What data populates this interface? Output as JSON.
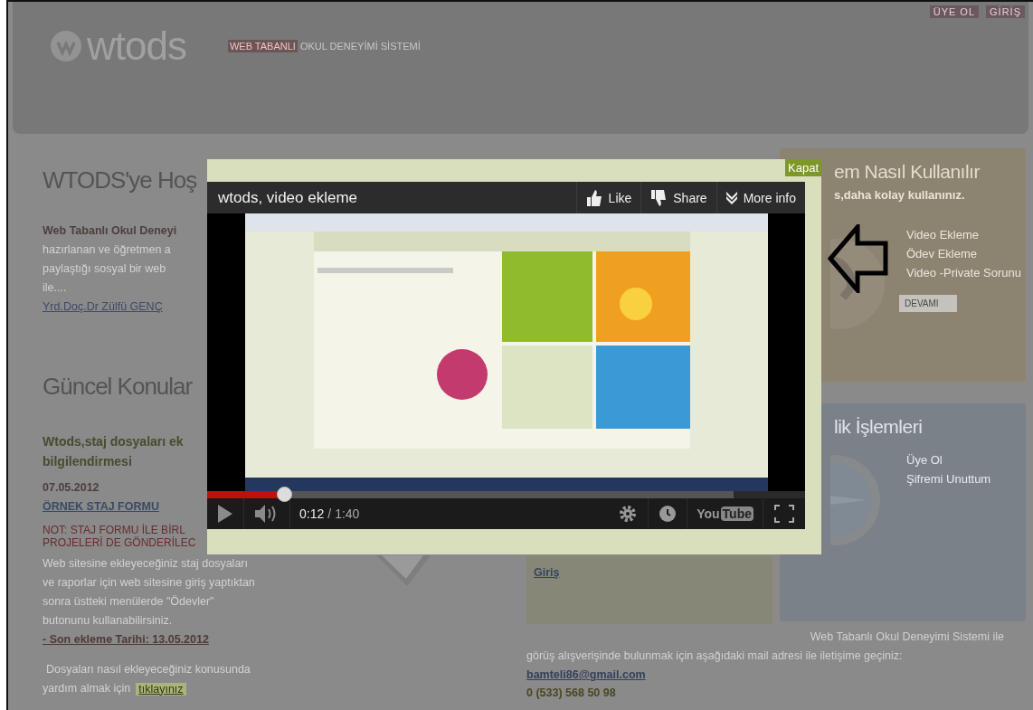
{
  "header": {
    "logo": "wtods",
    "tagline_highlight": "WEB TABANLI",
    "tagline": "OKUL DENEYİMİ SİSTEMİ",
    "top_links": [
      "ÜYE OL",
      "GİRİŞ"
    ]
  },
  "welcome": {
    "title": "WTODS'ye Hoş",
    "lead": "Web Tabanlı Okul Deneyi",
    "lines": [
      "hazırlanan ve öğretmen a",
      "paylaştığı sosyal bir web",
      "ile...."
    ],
    "author_link": "Yrd.Doç.Dr Zülfü GENÇ"
  },
  "news": {
    "title": "Güncel Konular",
    "headline_lines": [
      "Wtods,staj dosyaları ek",
      "bilgilendirmesi"
    ],
    "date": "07.05.2012",
    "form_link": "ÖRNEK STAJ FORMU",
    "notice_lines": [
      "NOT: STAJ FORMU İLE BİRL",
      "PROJELERİ DE GÖNDERİLEC"
    ],
    "body_lines": [
      "Web sitesine ekleyeceğiniz staj dosyaları",
      "ve raporlar için web sitesine giriş yaptıktan",
      "sonra üstteki menülerde \"Ödevler\"",
      "butonunu kullanabilirsiniz."
    ],
    "deadline": "- Son ekleme Tarihi: 13.05.2012",
    "help_lines": [
      "Dosyaları nasıl ekleyeceğiniz konusunda",
      "yardım almak için"
    ],
    "help_link": "tıklayınız"
  },
  "login_panel": {
    "link": "Giriş"
  },
  "usage_panel": {
    "title": "em Nasıl Kullanılır",
    "subtitle": "s,daha kolay kullanınız.",
    "items": [
      "Video Ekleme",
      "Ödev Ekleme",
      "Video -Private Sorunu"
    ],
    "button": "DEVAMI"
  },
  "membership_panel": {
    "title": "lik İşlemleri",
    "items": [
      "Üye Ol",
      "Şifremi Unuttum"
    ]
  },
  "contact": {
    "line_1": "Web Tabanlı Okul Deneyimi Sistemi ile",
    "line_2": "görüş alışverişinde bulunmak için aşağıdaki mail adresi ile iletişime geçiniz:",
    "email": "bamteli86@gmail.com",
    "phone": "0 (533) 568 50 98"
  },
  "modal": {
    "close": "Kapat",
    "video": {
      "title": "wtods, video ekleme",
      "actions": [
        "Like",
        "Share",
        "More info"
      ],
      "progress": {
        "level": 0.13
      },
      "buffer": {
        "level": 0.88
      },
      "time_current": "0:12",
      "time_separator": "/",
      "time_total": "1:40",
      "logo": [
        "You",
        "Tube"
      ]
    }
  }
}
